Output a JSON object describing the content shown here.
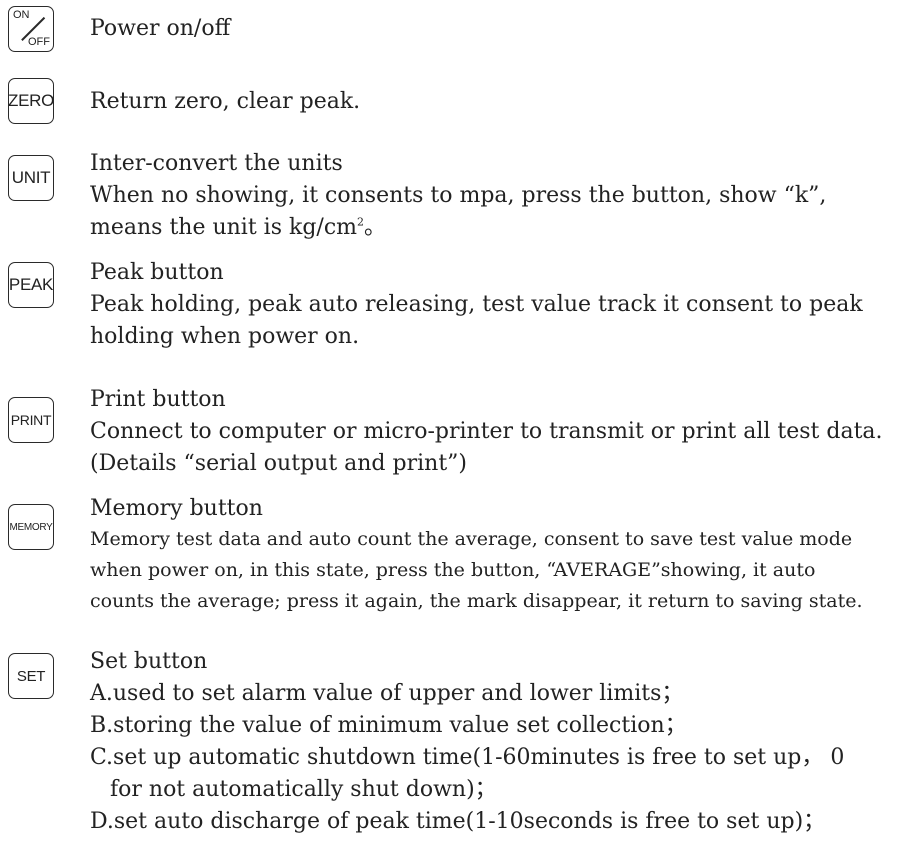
{
  "buttons": [
    {
      "key_label_top": "ON",
      "key_label_bottom": "OFF",
      "lines": [
        "Power on/off"
      ]
    },
    {
      "key_label": "ZERO",
      "lines": [
        "Return zero, clear peak."
      ]
    },
    {
      "key_label": "UNIT",
      "lines": [
        "Inter-convert the units",
        "When no showing, it consents to mpa, press the button, show “k”,",
        "means the unit is kg/cm",
        "2",
        "。"
      ]
    },
    {
      "key_label": "PEAK",
      "lines": [
        "Peak button",
        "Peak holding, peak auto releasing, test value track it consent to peak",
        "holding when power on."
      ]
    },
    {
      "key_label": "PRINT",
      "lines": [
        "Print button",
        "Connect to computer or micro-printer to transmit or print all test data.",
        "(Details “serial output and print”)"
      ]
    },
    {
      "key_label": "MEMORY",
      "lines": [
        "Memory button",
        "Memory test data and auto count the average, consent to save test value mode",
        "when power on, in this state, press the button, “AVERAGE”showing, it auto",
        "counts the average; press it again, the mark disappear, it return to saving state."
      ]
    },
    {
      "key_label": "SET",
      "lines": [
        "Set button",
        "A.used to set alarm value of upper and lower limits；",
        "B.storing the value of minimum value set collection；",
        "C.set up automatic shutdown time(1-60minutes is free to set up， 0",
        "for not automatically shut down)；",
        "D.set auto discharge of peak time(1-10seconds is free to set up)；"
      ]
    }
  ]
}
